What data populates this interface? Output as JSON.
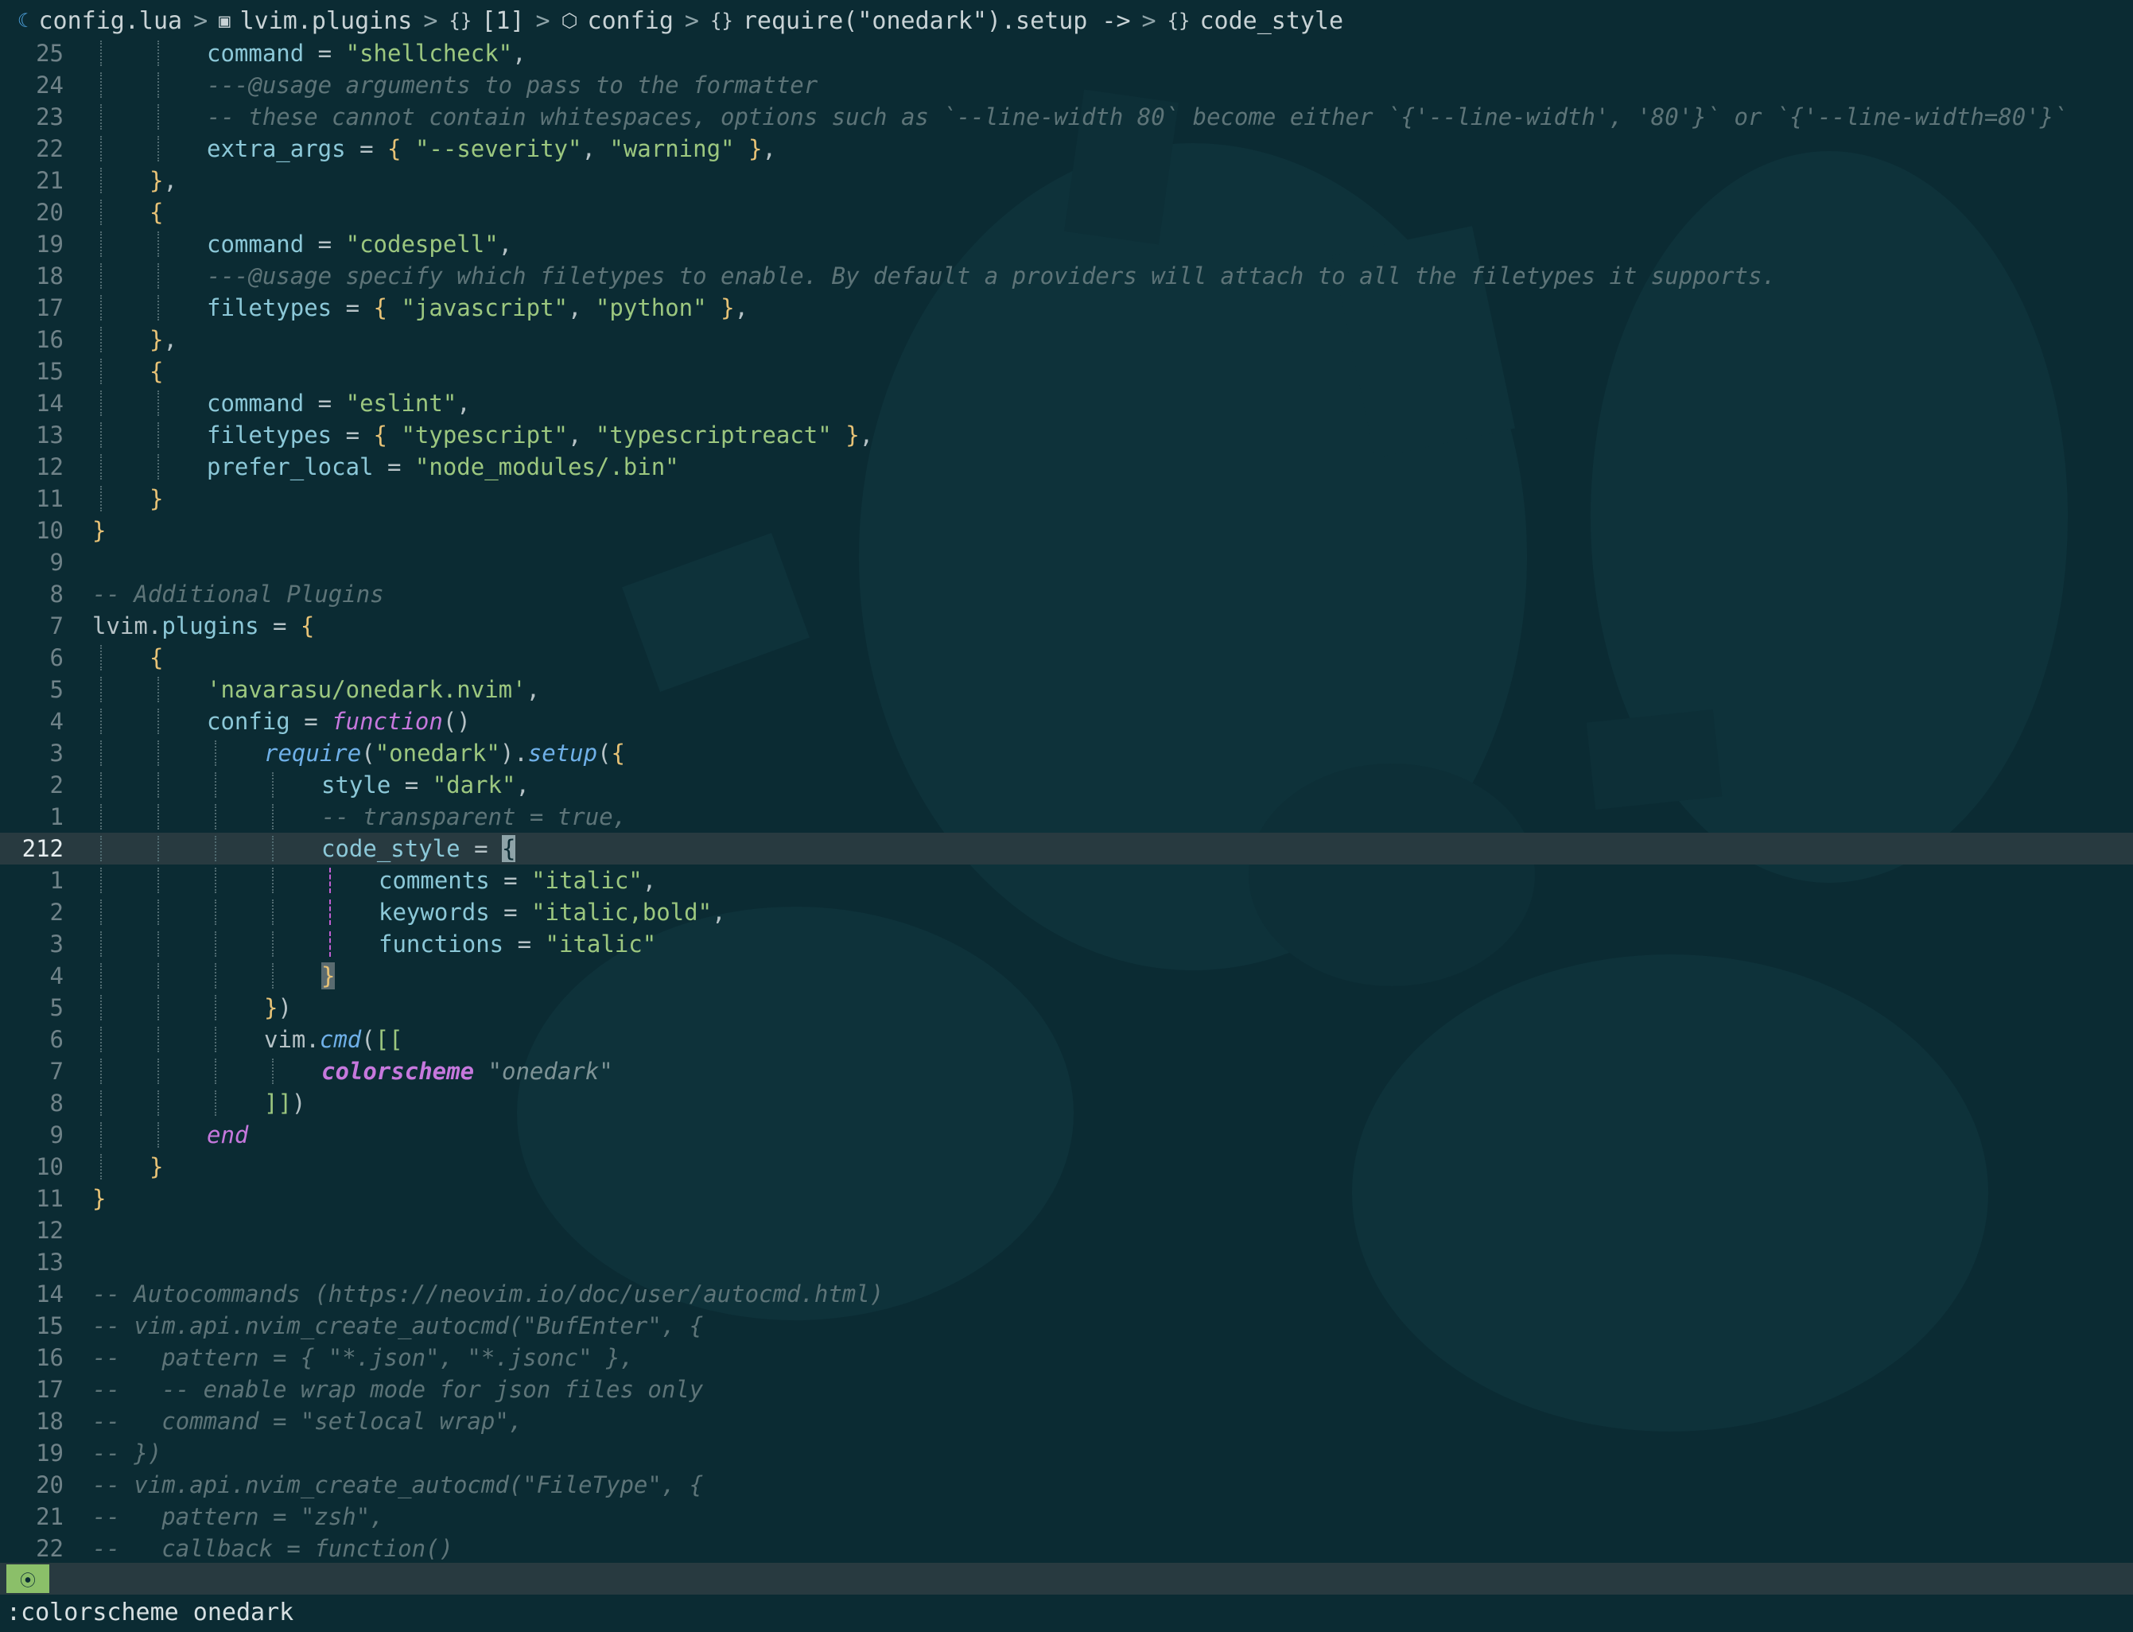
{
  "winbar": {
    "segments": [
      {
        "icon": "lua-file-icon",
        "glyph": "☾",
        "text": "config.lua"
      },
      {
        "icon": "module-icon",
        "glyph": "▣",
        "text": "lvim.plugins"
      },
      {
        "icon": "array-icon",
        "glyph": "{}",
        "text": "[1]"
      },
      {
        "icon": "package-icon",
        "glyph": "⬡",
        "text": "config"
      },
      {
        "icon": "object-icon",
        "glyph": "{}",
        "text": "require(\"onedark\").setup ->"
      },
      {
        "icon": "object-icon",
        "glyph": "{}",
        "text": "code_style"
      }
    ],
    "separator": ">"
  },
  "editor": {
    "cursor_line_number": "212",
    "lines": [
      {
        "n": "25",
        "depth": 2,
        "tokens": [
          [
            "t-field",
            "command"
          ],
          [
            "t-op",
            " = "
          ],
          [
            "t-str",
            "\"shellcheck\""
          ],
          [
            "t-op",
            ","
          ]
        ]
      },
      {
        "n": "24",
        "depth": 2,
        "tokens": [
          [
            "t-cmt",
            "---@usage arguments to pass to the formatter"
          ]
        ]
      },
      {
        "n": "23",
        "depth": 2,
        "tokens": [
          [
            "t-cmt",
            "-- these cannot contain whitespaces, options such as `--line-width 80` become either `{'--line-width', '80'}` or `{'--line-width=80'}`"
          ]
        ]
      },
      {
        "n": "22",
        "depth": 2,
        "tokens": [
          [
            "t-field",
            "extra_args"
          ],
          [
            "t-op",
            " = "
          ],
          [
            "t-brace",
            "{"
          ],
          [
            "t-op",
            " "
          ],
          [
            "t-str",
            "\"--severity\""
          ],
          [
            "t-op",
            ", "
          ],
          [
            "t-str",
            "\"warning\""
          ],
          [
            "t-op",
            " "
          ],
          [
            "t-brace",
            "}"
          ],
          [
            "t-op",
            ","
          ]
        ]
      },
      {
        "n": "21",
        "depth": 1,
        "tokens": [
          [
            "t-brace",
            "}"
          ],
          [
            "t-op",
            ","
          ]
        ]
      },
      {
        "n": "20",
        "depth": 1,
        "tokens": [
          [
            "t-brace",
            "{"
          ]
        ]
      },
      {
        "n": "19",
        "depth": 2,
        "tokens": [
          [
            "t-field",
            "command"
          ],
          [
            "t-op",
            " = "
          ],
          [
            "t-str",
            "\"codespell\""
          ],
          [
            "t-op",
            ","
          ]
        ]
      },
      {
        "n": "18",
        "depth": 2,
        "tokens": [
          [
            "t-cmt",
            "---@usage specify which filetypes to enable. By default a providers will attach to all the filetypes it supports."
          ]
        ]
      },
      {
        "n": "17",
        "depth": 2,
        "tokens": [
          [
            "t-field",
            "filetypes"
          ],
          [
            "t-op",
            " = "
          ],
          [
            "t-brace",
            "{"
          ],
          [
            "t-op",
            " "
          ],
          [
            "t-str",
            "\"javascript\""
          ],
          [
            "t-op",
            ", "
          ],
          [
            "t-str",
            "\"python\""
          ],
          [
            "t-op",
            " "
          ],
          [
            "t-brace",
            "}"
          ],
          [
            "t-op",
            ","
          ]
        ]
      },
      {
        "n": "16",
        "depth": 1,
        "tokens": [
          [
            "t-brace",
            "}"
          ],
          [
            "t-op",
            ","
          ]
        ]
      },
      {
        "n": "15",
        "depth": 1,
        "tokens": [
          [
            "t-brace",
            "{"
          ]
        ]
      },
      {
        "n": "14",
        "depth": 2,
        "tokens": [
          [
            "t-field",
            "command"
          ],
          [
            "t-op",
            " = "
          ],
          [
            "t-str",
            "\"eslint\""
          ],
          [
            "t-op",
            ","
          ]
        ]
      },
      {
        "n": "13",
        "depth": 2,
        "tokens": [
          [
            "t-field",
            "filetypes"
          ],
          [
            "t-op",
            " = "
          ],
          [
            "t-brace",
            "{"
          ],
          [
            "t-op",
            " "
          ],
          [
            "t-str",
            "\"typescript\""
          ],
          [
            "t-op",
            ", "
          ],
          [
            "t-str",
            "\"typescriptreact\""
          ],
          [
            "t-op",
            " "
          ],
          [
            "t-brace",
            "}"
          ],
          [
            "t-op",
            ","
          ]
        ]
      },
      {
        "n": "12",
        "depth": 2,
        "tokens": [
          [
            "t-field",
            "prefer_local"
          ],
          [
            "t-op",
            " = "
          ],
          [
            "t-str",
            "\"node_modules/.bin\""
          ]
        ]
      },
      {
        "n": "11",
        "depth": 1,
        "tokens": [
          [
            "t-brace",
            "}"
          ]
        ]
      },
      {
        "n": "10",
        "depth": 0,
        "tokens": [
          [
            "t-brace",
            "}"
          ]
        ]
      },
      {
        "n": "9",
        "depth": 0,
        "tokens": []
      },
      {
        "n": "8",
        "depth": 0,
        "tokens": [
          [
            "t-cmt",
            "-- Additional Plugins"
          ]
        ]
      },
      {
        "n": "7",
        "depth": 0,
        "tokens": [
          [
            "t-def",
            "lvim"
          ],
          [
            "t-op",
            "."
          ],
          [
            "t-field",
            "plugins"
          ],
          [
            "t-op",
            " = "
          ],
          [
            "t-brace",
            "{"
          ]
        ]
      },
      {
        "n": "6",
        "depth": 1,
        "tokens": [
          [
            "t-brace",
            "{"
          ]
        ]
      },
      {
        "n": "5",
        "depth": 2,
        "tokens": [
          [
            "t-str",
            "'navarasu/onedark.nvim'"
          ],
          [
            "t-op",
            ","
          ]
        ]
      },
      {
        "n": "4",
        "depth": 2,
        "tokens": [
          [
            "t-field",
            "config"
          ],
          [
            "t-op",
            " = "
          ],
          [
            "t-func",
            "function"
          ],
          [
            "t-paren",
            "()"
          ]
        ]
      },
      {
        "n": "3",
        "depth": 3,
        "tokens": [
          [
            "t-fn",
            "require"
          ],
          [
            "t-paren",
            "("
          ],
          [
            "t-str",
            "\"onedark\""
          ],
          [
            "t-paren",
            ")"
          ],
          [
            "t-op",
            "."
          ],
          [
            "t-fn",
            "setup"
          ],
          [
            "t-paren",
            "("
          ],
          [
            "t-brace",
            "{"
          ]
        ]
      },
      {
        "n": "2",
        "depth": 4,
        "tokens": [
          [
            "t-field",
            "style"
          ],
          [
            "t-op",
            " = "
          ],
          [
            "t-str",
            "\"dark\""
          ],
          [
            "t-op",
            ","
          ]
        ]
      },
      {
        "n": "1",
        "depth": 4,
        "tokens": [
          [
            "t-cmt",
            "-- transparent = true,"
          ]
        ]
      },
      {
        "n": "212",
        "depth": 4,
        "cursor": true,
        "tokens": [
          [
            "t-field",
            "code_style"
          ],
          [
            "t-op",
            " = "
          ],
          [
            "t-cursor",
            "{"
          ]
        ]
      },
      {
        "n": "1",
        "depth": 5,
        "mag": true,
        "tokens": [
          [
            "t-field",
            "comments"
          ],
          [
            "t-op",
            " = "
          ],
          [
            "t-str",
            "\"italic\""
          ],
          [
            "t-op",
            ","
          ]
        ]
      },
      {
        "n": "2",
        "depth": 5,
        "mag": true,
        "tokens": [
          [
            "t-field",
            "keywords"
          ],
          [
            "t-op",
            " = "
          ],
          [
            "t-str",
            "\"italic,bold\""
          ],
          [
            "t-op",
            ","
          ]
        ]
      },
      {
        "n": "3",
        "depth": 5,
        "mag": true,
        "tokens": [
          [
            "t-field",
            "functions"
          ],
          [
            "t-op",
            " = "
          ],
          [
            "t-str",
            "\"italic\""
          ]
        ]
      },
      {
        "n": "4",
        "depth": 4,
        "tokens": [
          [
            "t-match",
            "}"
          ]
        ]
      },
      {
        "n": "5",
        "depth": 3,
        "tokens": [
          [
            "t-brace",
            "}"
          ],
          [
            "t-paren",
            ")"
          ]
        ]
      },
      {
        "n": "6",
        "depth": 3,
        "tokens": [
          [
            "t-def",
            "vim"
          ],
          [
            "t-op",
            "."
          ],
          [
            "t-fn",
            "cmd"
          ],
          [
            "t-paren",
            "("
          ],
          [
            "t-str",
            "[["
          ]
        ]
      },
      {
        "n": "7",
        "depth": 4,
        "tokens": [
          [
            "t-kw",
            "colorscheme"
          ],
          [
            "t-op",
            " "
          ],
          [
            "t-strit",
            "\"onedark\""
          ]
        ]
      },
      {
        "n": "8",
        "depth": 3,
        "tokens": [
          [
            "t-str",
            "]]"
          ],
          [
            "t-paren",
            ")"
          ]
        ]
      },
      {
        "n": "9",
        "depth": 2,
        "tokens": [
          [
            "t-func",
            "end"
          ]
        ]
      },
      {
        "n": "10",
        "depth": 1,
        "tokens": [
          [
            "t-brace",
            "}"
          ]
        ]
      },
      {
        "n": "11",
        "depth": 0,
        "tokens": [
          [
            "t-brace",
            "}"
          ]
        ]
      },
      {
        "n": "12",
        "depth": 0,
        "tokens": []
      },
      {
        "n": "13",
        "depth": 0,
        "tokens": []
      },
      {
        "n": "14",
        "depth": 0,
        "tokens": [
          [
            "t-cmt",
            "-- Autocommands (https://neovim.io/doc/user/autocmd.html)"
          ]
        ]
      },
      {
        "n": "15",
        "depth": 0,
        "tokens": [
          [
            "t-cmt",
            "-- vim.api.nvim_create_autocmd(\"BufEnter\", {"
          ]
        ]
      },
      {
        "n": "16",
        "depth": 0,
        "tokens": [
          [
            "t-cmt",
            "--   pattern = { \"*.json\", \"*.jsonc\" },"
          ]
        ]
      },
      {
        "n": "17",
        "depth": 0,
        "tokens": [
          [
            "t-cmt",
            "--   -- enable wrap mode for json files only"
          ]
        ]
      },
      {
        "n": "18",
        "depth": 0,
        "tokens": [
          [
            "t-cmt",
            "--   command = \"setlocal wrap\","
          ]
        ]
      },
      {
        "n": "19",
        "depth": 0,
        "tokens": [
          [
            "t-cmt",
            "-- })"
          ]
        ]
      },
      {
        "n": "20",
        "depth": 0,
        "tokens": [
          [
            "t-cmt",
            "-- vim.api.nvim_create_autocmd(\"FileType\", {"
          ]
        ]
      },
      {
        "n": "21",
        "depth": 0,
        "tokens": [
          [
            "t-cmt",
            "--   pattern = \"zsh\","
          ]
        ]
      },
      {
        "n": "22",
        "depth": 0,
        "tokens": [
          [
            "t-cmt",
            "--   callback = function()"
          ]
        ]
      }
    ]
  },
  "statusline": {
    "mode_icon": "lsp-status-icon",
    "mode_glyph": "⦿"
  },
  "cmdline": {
    "text": ":colorscheme onedark"
  },
  "colors": {
    "background": "#0b2b33",
    "cursorline": "#283a40",
    "string": "#9cc77f",
    "field": "#8cc8d8",
    "brace": "#e7c276",
    "keyword": "#c678dd",
    "function": "#6fb0e8",
    "comment": "#5d7478",
    "mode_accent": "#8bbf69"
  }
}
